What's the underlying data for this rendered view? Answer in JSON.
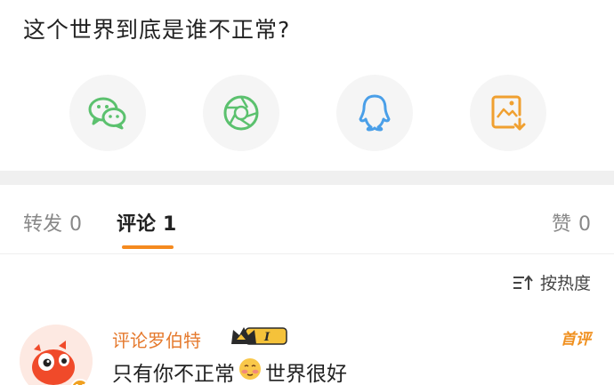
{
  "post": {
    "title": "这个世界到底是谁不正常?"
  },
  "share": [
    {
      "icon": "wechat-icon",
      "color": "#5bc16e"
    },
    {
      "icon": "moments-icon",
      "color": "#5bc16e"
    },
    {
      "icon": "qq-icon",
      "color": "#4a9fe8"
    },
    {
      "icon": "save-image-icon",
      "color": "#f0a030"
    }
  ],
  "tabs": {
    "repost": {
      "label": "转发",
      "count": "0"
    },
    "comments": {
      "label": "评论",
      "count": "1"
    },
    "likes": {
      "label": "赞",
      "count": "0"
    },
    "accent": "#f58a1f"
  },
  "sort": {
    "label": "按热度"
  },
  "comment": {
    "username": "评论罗伯特",
    "vip_level": "I",
    "tag": "首评",
    "text_before": "只有你不正常",
    "text_after": "世界很好",
    "username_color": "#e57a2e"
  }
}
